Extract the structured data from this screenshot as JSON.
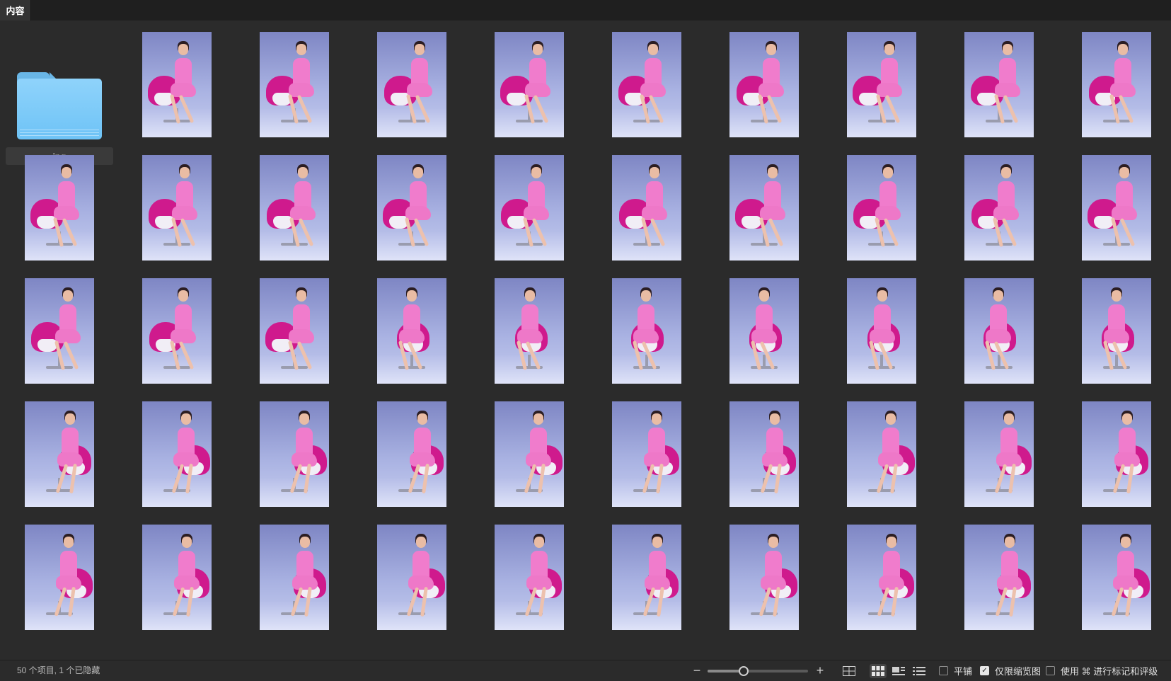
{
  "tab": {
    "label": "内容"
  },
  "folder": {
    "label": "jpg"
  },
  "grid": {
    "photo_count": 49,
    "columns": 10,
    "rows": 5
  },
  "statusbar": {
    "item_count_text": "50 个项目, 1 个已隐藏",
    "zoom_level": 0.35,
    "tile_label": "平铺",
    "tile_checked": false,
    "thumb_only_label": "仅限缩览图",
    "thumb_only_checked": true,
    "mark_label": "使用 ⌘ 进行标记和评级",
    "mark_checked": false
  },
  "colors": {
    "background": "#2b2b2b",
    "folder": "#6ec3f6",
    "photo_backdrop": "#a9b2e2",
    "chair": "#cf1a8d",
    "dress": "#f07ccc"
  }
}
